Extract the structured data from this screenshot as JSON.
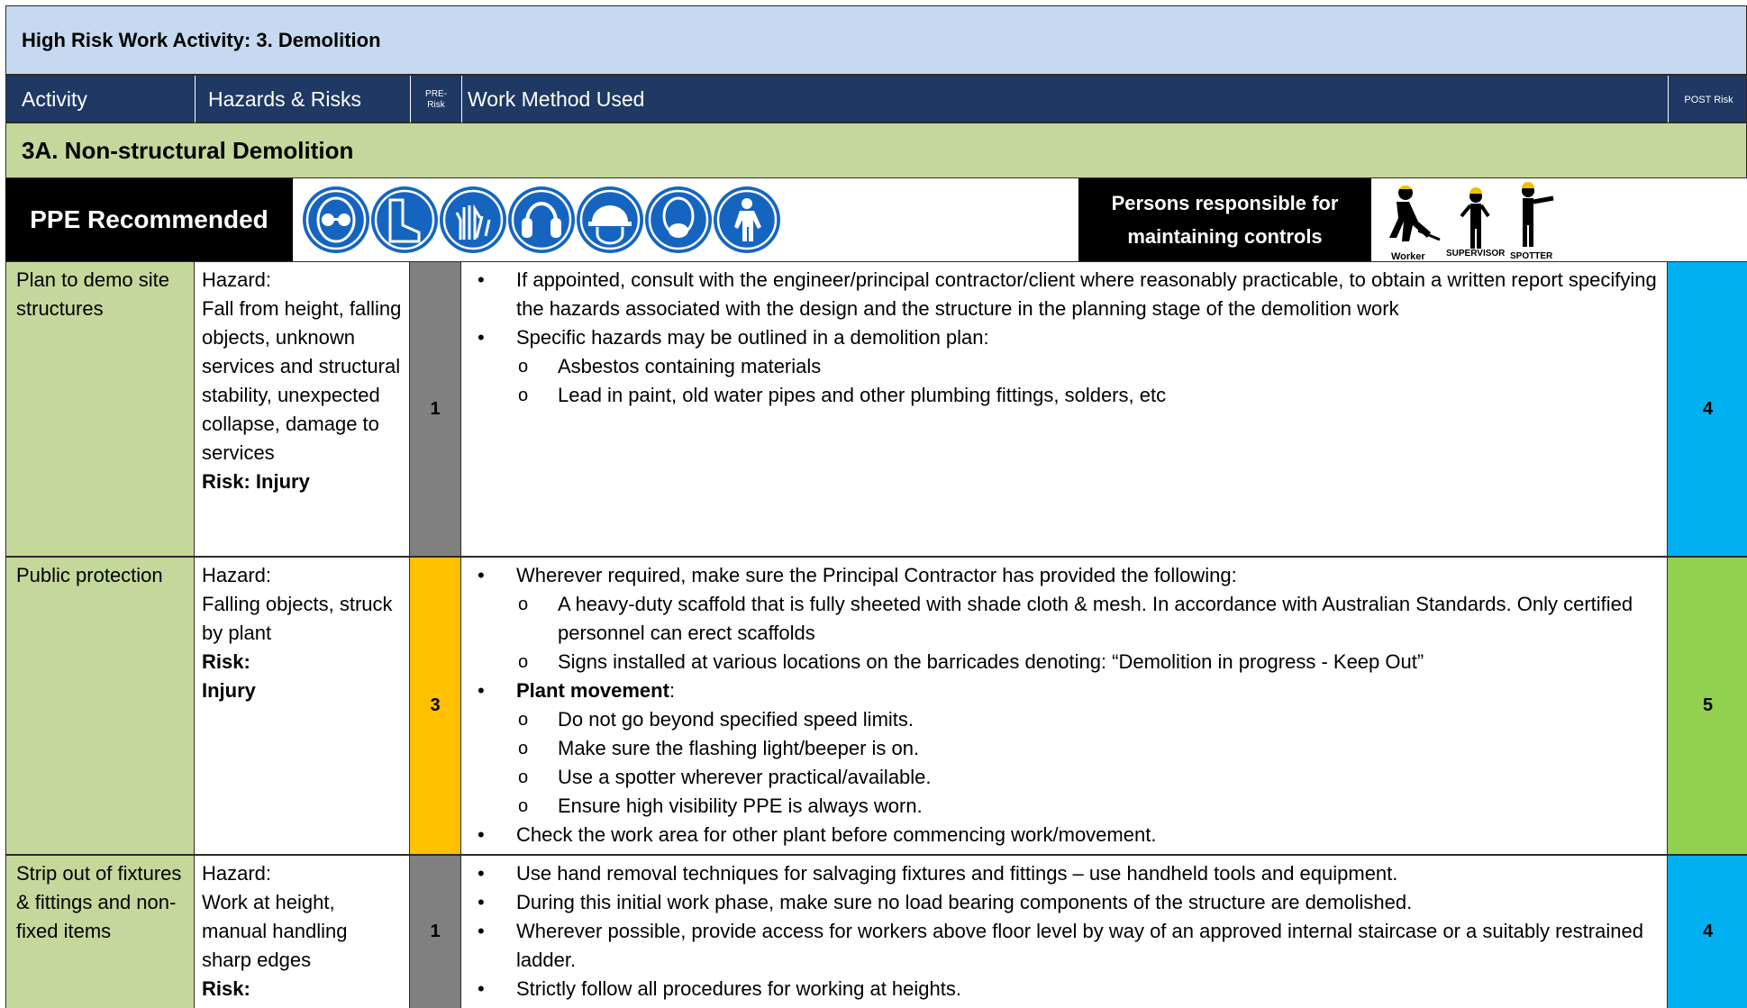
{
  "title": "High Risk Work Activity: 3. Demolition",
  "header": {
    "activity": "Activity",
    "hazards": "Hazards & Risks",
    "pre_risk": "PRE-\nRisk",
    "work_method": "Work Method Used",
    "post_risk": "POST Risk"
  },
  "section_title": "3A. Non-structural Demolition",
  "ppe": {
    "label": "PPE Recommended",
    "icons": [
      "safety-glasses-icon",
      "safety-boots-icon",
      "gloves-icon",
      "hearing-protection-icon",
      "hard-hat-icon",
      "dust-mask-icon",
      "coveralls-icon"
    ],
    "icon_color": "#1565c0"
  },
  "persons": {
    "label_line1": "Persons responsible for",
    "label_line2": "maintaining controls",
    "roles": [
      "Worker",
      "SUPERVISOR",
      "SPOTTER"
    ]
  },
  "risk_colors": {
    "grey": "#808080",
    "orange": "#ffc000",
    "blue": "#00b0f0",
    "green": "#92d050"
  },
  "rows": [
    {
      "activity": "Plan to demo site structures",
      "hazard_label": "Hazard:",
      "hazard_text": "Fall from height, falling objects, unknown services and structural stability, unexpected collapse, damage to services",
      "risk_label": "Risk: Injury",
      "pre_risk": "1",
      "post_risk": "4",
      "methods": [
        {
          "level": 1,
          "text": "If appointed, consult with the engineer/principal contractor/client where reasonably practicable, to obtain a written report specifying the hazards associated with the design and the structure in the planning stage of the demolition work"
        },
        {
          "level": 1,
          "text": "Specific hazards may be outlined in a demolition plan:"
        },
        {
          "level": 2,
          "text": "Asbestos containing materials"
        },
        {
          "level": 2,
          "text": "Lead in paint, old water pipes and other plumbing fittings, solders, etc"
        }
      ]
    },
    {
      "activity": "Public protection",
      "hazard_label": "Hazard:",
      "hazard_text": "Falling objects, struck by plant",
      "risk_label": "Risk:",
      "risk_value": "Injury",
      "pre_risk": "3",
      "post_risk": "5",
      "methods": [
        {
          "level": 1,
          "text": "Wherever required, make sure the Principal Contractor has provided the following:"
        },
        {
          "level": 2,
          "text": "A heavy-duty scaffold that is fully sheeted with shade cloth & mesh. In accordance with Australian Standards. Only certified personnel can erect scaffolds"
        },
        {
          "level": 2,
          "text": "Signs installed at various locations on the barricades denoting: “Demolition in progress - Keep Out”"
        },
        {
          "level": 1,
          "bold": "Plant movement",
          "text": ":"
        },
        {
          "level": 2,
          "text": "Do not go beyond specified speed limits."
        },
        {
          "level": 2,
          "text": "Make sure the flashing light/beeper is on."
        },
        {
          "level": 2,
          "text": "Use a spotter wherever practical/available."
        },
        {
          "level": 2,
          "text": "Ensure high visibility PPE is always worn."
        },
        {
          "level": 1,
          "text": "Check the work area for other plant before commencing work/movement."
        }
      ]
    },
    {
      "activity": "Strip out of fixtures & fittings and non-fixed items",
      "hazard_label": "Hazard:",
      "hazard_text": "Work at height, manual handling sharp edges",
      "risk_label": "Risk:",
      "pre_risk": "1",
      "post_risk": "4",
      "methods": [
        {
          "level": 1,
          "text": "Use hand removal techniques for salvaging fixtures and fittings – use handheld tools and equipment."
        },
        {
          "level": 1,
          "text": "During this initial work phase, make sure no load bearing components of the structure are demolished."
        },
        {
          "level": 1,
          "text": "Wherever possible, provide access for workers above floor level by way of an approved internal staircase or a suitably restrained ladder."
        },
        {
          "level": 1,
          "text": "Strictly follow all procedures for working at heights."
        }
      ]
    }
  ]
}
